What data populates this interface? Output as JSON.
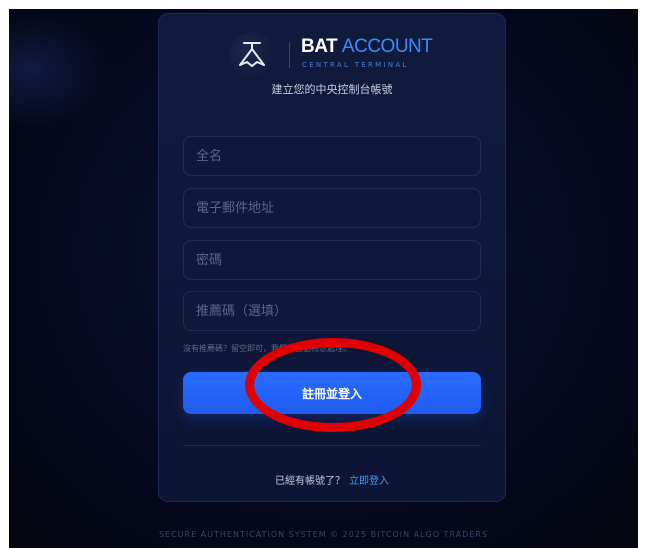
{
  "brand": {
    "word1": "BAT",
    "word2": "ACCOUNT",
    "subtitle": "CENTRAL TERMINAL",
    "tagline": "建立您的中央控制台帳號"
  },
  "form": {
    "fullname_placeholder": "全名",
    "email_placeholder": "電子郵件地址",
    "password_placeholder": "密碼",
    "referral_placeholder": "推薦碼（選填）",
    "hint": "沒有推薦碼？留空即可，我們會自動為您處理。",
    "submit_label": "註冊並登入"
  },
  "login": {
    "prompt": "已經有帳號了？",
    "link_label": "立即登入"
  },
  "footer": "SECURE AUTHENTICATION SYSTEM © 2025 BITCOIN ALGO TRADERS",
  "colors": {
    "accent": "#2a6bff",
    "link": "#4a9cff",
    "annotation": "#e00000"
  }
}
